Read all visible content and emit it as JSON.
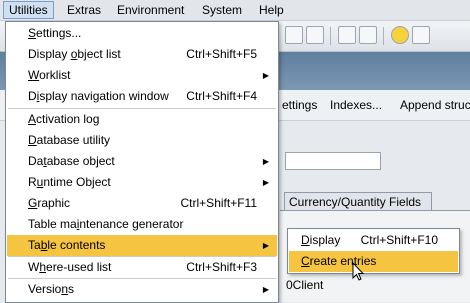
{
  "menubar": [
    "Utilities",
    "Extras",
    "Environment",
    "System",
    "Help"
  ],
  "background": {
    "tabs_partial": [
      "ettings",
      "Indexes...",
      "Append struc"
    ],
    "qty_tab": "Currency/Quantity Fields",
    "client_label": "0Client"
  },
  "menu": {
    "items": [
      {
        "label": "Settings...",
        "shortcut": "",
        "submenu": false
      },
      {
        "label": "Display object list",
        "shortcut": "Ctrl+Shift+F5",
        "submenu": false
      },
      {
        "label": "Worklist",
        "shortcut": "",
        "submenu": true
      },
      {
        "label": "Display navigation window",
        "shortcut": "Ctrl+Shift+F4",
        "submenu": false
      },
      {
        "label": "Activation log",
        "shortcut": "",
        "submenu": false
      },
      {
        "label": "Database utility",
        "shortcut": "",
        "submenu": false
      },
      {
        "label": "Database object",
        "shortcut": "",
        "submenu": true
      },
      {
        "label": "Runtime Object",
        "shortcut": "",
        "submenu": true
      },
      {
        "label": "Graphic",
        "shortcut": "Ctrl+Shift+F11",
        "submenu": false
      },
      {
        "label": "Table maintenance generator",
        "shortcut": "",
        "submenu": false
      },
      {
        "label": "Table contents",
        "shortcut": "",
        "submenu": true
      },
      {
        "label": "Where-used list",
        "shortcut": "Ctrl+Shift+F3",
        "submenu": false
      },
      {
        "label": "Versions",
        "shortcut": "",
        "submenu": true
      }
    ]
  },
  "submenu": {
    "items": [
      {
        "label": "Display",
        "shortcut": "Ctrl+Shift+F10"
      },
      {
        "label": "Create entries",
        "shortcut": ""
      }
    ]
  },
  "colors": {
    "highlight": "#f5c440",
    "menubar": "#e2e6ea",
    "titleband": "#6a89a8"
  }
}
